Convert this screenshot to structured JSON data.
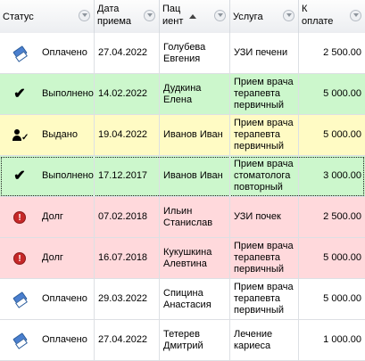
{
  "columns": {
    "status": "Статус",
    "date": "Дата\nприема",
    "patient": "Пац\nиент",
    "service": "Услуга",
    "payment": "К\nоплате"
  },
  "rows": [
    {
      "icon": "payment-tag-icon",
      "status": "Оплачено",
      "date": "27.04.2022",
      "patient": "Голубева\nЕвгения",
      "service": "УЗИ печени",
      "payment": "2 500.00",
      "bg": "#ffffff"
    },
    {
      "icon": "checkmark-icon",
      "status": "Выполнено",
      "date": "14.02.2022",
      "patient": "Дудкина\nЕлена",
      "service": "Прием врача\nтерапевта\nпервичный",
      "payment": "5 000.00",
      "bg": "#ccf7cc"
    },
    {
      "icon": "person-check-icon",
      "status": "Выдано",
      "date": "19.04.2022",
      "patient": "Иванов Иван",
      "service": "Прием врача\nтерапевта\nпервичный",
      "payment": "5 000.00",
      "bg": "#fffbc4"
    },
    {
      "icon": "checkmark-icon",
      "status": "Выполнено",
      "date": "17.12.2017",
      "patient": "Иванов Иван",
      "service": "Прием врача\nстоматолога\nповторный",
      "payment": "3 000.00",
      "bg": "#ccf7cc"
    },
    {
      "icon": "debt-alert-icon",
      "status": "Долг",
      "date": "07.02.2018",
      "patient": "Ильин\nСтанислав",
      "service": "УЗИ почек",
      "payment": "2 500.00",
      "bg": "#ffd9dc"
    },
    {
      "icon": "debt-alert-icon",
      "status": "Долг",
      "date": "16.07.2018",
      "patient": "Кукушкина\nАлевтина",
      "service": "Прием врача\nтерапевта\nпервичный",
      "payment": "5 000.00",
      "bg": "#ffd9dc"
    },
    {
      "icon": "payment-tag-icon",
      "status": "Оплачено",
      "date": "29.03.2022",
      "patient": "Спицина\nАнастасия",
      "service": "Прием врача\nтерапевта\nпервичный",
      "payment": "5 000.00",
      "bg": "#ffffff"
    },
    {
      "icon": "payment-tag-icon",
      "status": "Оплачено",
      "date": "27.04.2022",
      "patient": "Тетерев\nДмитрий",
      "service": "Лечение\nкариеса",
      "payment": "1 000.00",
      "bg": "#ffffff"
    }
  ],
  "selected_row_index": 3,
  "sort": {
    "column": "patient",
    "direction": "ascending"
  }
}
